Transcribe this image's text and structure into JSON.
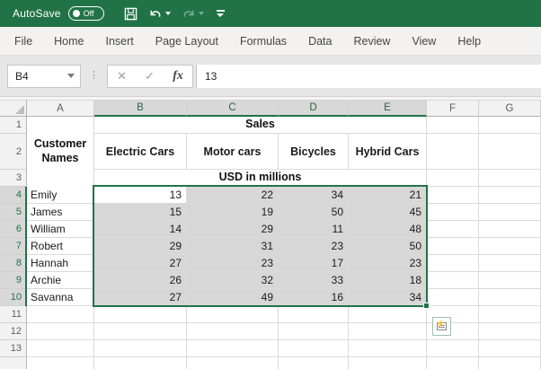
{
  "titlebar": {
    "autosave_label": "AutoSave",
    "autosave_state": "Off"
  },
  "ribbon_tabs": [
    "File",
    "Home",
    "Insert",
    "Page Layout",
    "Formulas",
    "Data",
    "Review",
    "View",
    "Help"
  ],
  "formula_bar": {
    "name_box": "B4",
    "cancel": "✕",
    "enter": "✓",
    "fx": "fx",
    "value": "13"
  },
  "icons": {
    "quick_analysis_bolt": "⚡",
    "dots_separator": "⋮"
  },
  "sheet": {
    "col_letters": [
      "A",
      "B",
      "C",
      "D",
      "E",
      "F",
      "G"
    ],
    "selected_cols": [
      "B",
      "C",
      "D",
      "E"
    ],
    "selected_rows_from": 4,
    "selected_rows_to": 10,
    "visible_row_numbers": [
      1,
      2,
      3,
      4,
      5,
      6,
      7,
      8,
      9,
      10,
      11,
      12,
      13
    ],
    "active_cell": "B4",
    "merged": {
      "customer": "Customer Names",
      "sales": "Sales",
      "usd": "USD in millions"
    },
    "product_headers": [
      "Electric Cars",
      "Motor cars",
      "Bicycles",
      "Hybrid Cars"
    ],
    "rows": [
      {
        "row": 4,
        "name": "Emily",
        "values": [
          13,
          22,
          34,
          21
        ]
      },
      {
        "row": 5,
        "name": "James",
        "values": [
          15,
          19,
          50,
          45
        ]
      },
      {
        "row": 6,
        "name": "William",
        "values": [
          14,
          29,
          11,
          48
        ]
      },
      {
        "row": 7,
        "name": "Robert",
        "values": [
          29,
          31,
          23,
          50
        ]
      },
      {
        "row": 8,
        "name": "Hannah",
        "values": [
          27,
          23,
          17,
          23
        ]
      },
      {
        "row": 9,
        "name": "Archie",
        "values": [
          26,
          32,
          33,
          18
        ]
      },
      {
        "row": 10,
        "name": "Savanna",
        "values": [
          27,
          49,
          16,
          34
        ]
      }
    ]
  },
  "colors": {
    "brand_green": "#217346",
    "selection_fill": "#d7d7d7",
    "selected_header_bg": "#d8d8d8",
    "header_bg": "#f2f2f2",
    "gridline": "#dadada"
  }
}
